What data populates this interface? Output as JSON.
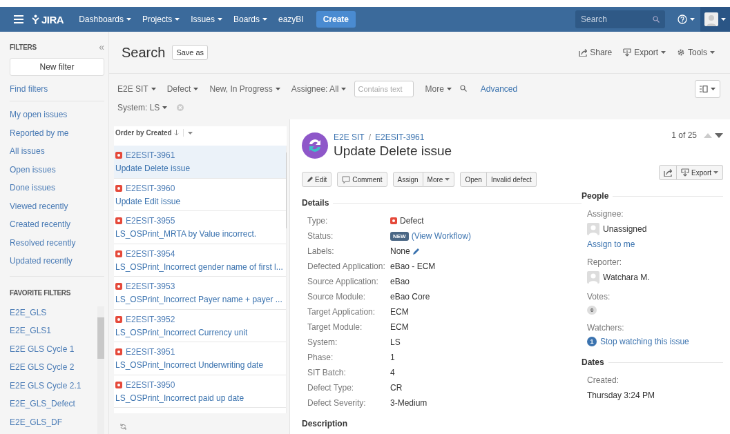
{
  "nav": {
    "brand": "JIRA",
    "items": [
      {
        "label": "Dashboards",
        "dropdown": true
      },
      {
        "label": "Projects",
        "dropdown": true
      },
      {
        "label": "Issues",
        "dropdown": true
      },
      {
        "label": "Boards",
        "dropdown": true
      },
      {
        "label": "eazyBI",
        "dropdown": false
      }
    ],
    "create": "Create",
    "search": {
      "placeholder": "Search"
    }
  },
  "sidebar": {
    "title": "FILTERS",
    "collapse": "«",
    "new_filter": "New filter",
    "find_filters": "Find filters",
    "links": [
      "My open issues",
      "Reported by me",
      "All issues",
      "Open issues",
      "Done issues",
      "Viewed recently",
      "Created recently",
      "Resolved recently",
      "Updated recently"
    ],
    "favorites_title": "FAVORITE FILTERS",
    "favorites": [
      "E2E_GLS",
      "E2E_GLS1",
      "E2E GLS Cycle 1",
      "E2E GLS Cycle 2",
      "E2E GLS Cycle 2.1",
      "E2E_GLS_Defect",
      "E2E_GLS_DF"
    ]
  },
  "header": {
    "title": "Search",
    "save_as": "Save as",
    "actions": [
      {
        "label": "Share",
        "kind": "share",
        "dropdown": false
      },
      {
        "label": "Export",
        "kind": "export",
        "dropdown": true
      },
      {
        "label": "Tools",
        "kind": "tools",
        "dropdown": true
      }
    ]
  },
  "filter_bar": {
    "chips": [
      {
        "label": "E2E SIT"
      },
      {
        "label": "Defect"
      },
      {
        "label": "New, In Progress"
      },
      {
        "label": "Assignee: All"
      }
    ],
    "text": {
      "placeholder": "Contains text"
    },
    "more": "More",
    "advanced": "Advanced",
    "extra_chips": [
      {
        "label": "System: LS"
      }
    ]
  },
  "issue_list": {
    "order": "Order by Created",
    "issues": [
      {
        "key": "E2ESIT-3961",
        "summary": "Update Delete issue",
        "selected": true
      },
      {
        "key": "E2ESIT-3960",
        "summary": "Update Edit issue",
        "selected": false
      },
      {
        "key": "E2ESIT-3955",
        "summary": "LS_OSPrint_MRTA by Value incorrect.",
        "selected": false
      },
      {
        "key": "E2ESIT-3954",
        "summary": "LS_OSPrint_Incorrect gender name of first l...",
        "selected": false
      },
      {
        "key": "E2ESIT-3953",
        "summary": "LS_OSPrint_Incorrect Payer name + payer ...",
        "selected": false
      },
      {
        "key": "E2ESIT-3952",
        "summary": "LS_OSPrint_Incorrect Currency unit",
        "selected": false
      },
      {
        "key": "E2ESIT-3951",
        "summary": "LS_OSPrint_Incorrect Underwriting date",
        "selected": false
      },
      {
        "key": "E2ESIT-3950",
        "summary": "LS_OSPrint_Incorrect paid up date",
        "selected": false
      }
    ]
  },
  "issue": {
    "project": "E2E SIT",
    "separator": "/",
    "key": "E2ESIT-3961",
    "title": "Update Delete issue",
    "pager": "1 of 25",
    "buttons": [
      [
        {
          "label": "Edit",
          "kind": "edit"
        }
      ],
      [
        {
          "label": "Comment",
          "kind": "comment"
        }
      ],
      [
        {
          "label": "Assign",
          "kind": "plain"
        },
        {
          "label": "More",
          "kind": "menu"
        }
      ],
      [
        {
          "label": "Open",
          "kind": "plain"
        },
        {
          "label": "Invalid defect",
          "kind": "plain"
        }
      ]
    ],
    "export": "Export",
    "details_title": "Details",
    "fields": [
      {
        "label": "Type:",
        "value": "Defect",
        "kind": "type"
      },
      {
        "label": "Status:",
        "value": "NEW",
        "link": "(View Workflow)",
        "kind": "status"
      },
      {
        "label": "Labels:",
        "value": "None",
        "kind": "labels"
      },
      {
        "label": "Defected Application:",
        "value": "eBao - ECM",
        "kind": "text"
      },
      {
        "label": "Source Application:",
        "value": "eBao",
        "kind": "text"
      },
      {
        "label": "Source Module:",
        "value": "eBao Core",
        "kind": "text"
      },
      {
        "label": "Target Application:",
        "value": "ECM",
        "kind": "text"
      },
      {
        "label": "Target Module:",
        "value": "ECM",
        "kind": "text"
      },
      {
        "label": "System:",
        "value": "LS",
        "kind": "text"
      },
      {
        "label": "Phase:",
        "value": "1",
        "kind": "text"
      },
      {
        "label": "SIT Batch:",
        "value": "4",
        "kind": "text"
      },
      {
        "label": "Defect Type:",
        "value": "CR",
        "kind": "text"
      },
      {
        "label": "Defect Severity:",
        "value": "3-Medium",
        "kind": "text"
      }
    ],
    "description_title": "Description",
    "people_title": "People",
    "assignee_label": "Assignee:",
    "assignee": "Unassigned",
    "assign_to_me": "Assign to me",
    "reporter_label": "Reporter:",
    "reporter": "Watchara M.",
    "votes_label": "Votes:",
    "votes": "0",
    "watchers_label": "Watchers:",
    "watchers": "1",
    "stop_watching": "Stop watching this issue",
    "dates_title": "Dates",
    "created_label": "Created:",
    "created": "Thursday 3:24 PM"
  }
}
